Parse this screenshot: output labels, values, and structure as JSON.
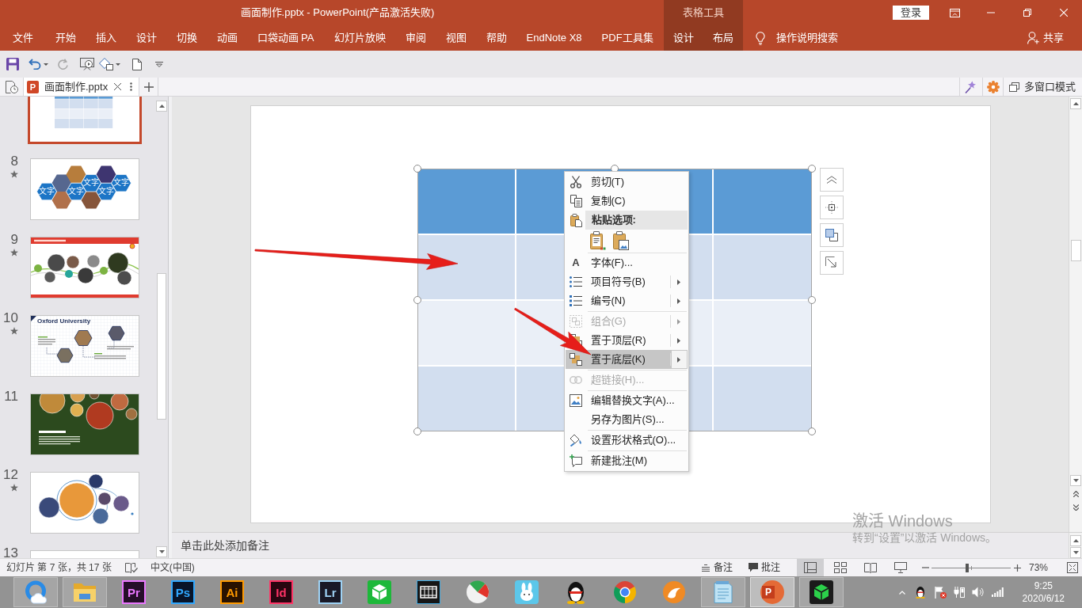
{
  "window": {
    "title": "画面制作.pptx - PowerPoint(产品激活失败)",
    "tool_group": "表格工具",
    "sign_in": "登录"
  },
  "ribbon_tabs": [
    {
      "label": "文件",
      "kind": "main"
    },
    {
      "label": "开始",
      "kind": "main"
    },
    {
      "label": "插入",
      "kind": "main"
    },
    {
      "label": "设计",
      "kind": "main"
    },
    {
      "label": "切换",
      "kind": "main"
    },
    {
      "label": "动画",
      "kind": "main"
    },
    {
      "label": "口袋动画 PA",
      "kind": "main"
    },
    {
      "label": "幻灯片放映",
      "kind": "main"
    },
    {
      "label": "审阅",
      "kind": "main"
    },
    {
      "label": "视图",
      "kind": "main"
    },
    {
      "label": "帮助",
      "kind": "main"
    },
    {
      "label": "EndNote X8",
      "kind": "main"
    },
    {
      "label": "PDF工具集",
      "kind": "main"
    },
    {
      "label": "设计",
      "kind": "contextual"
    },
    {
      "label": "布局",
      "kind": "contextual"
    }
  ],
  "tell_me": "操作说明搜索",
  "share": "共享",
  "document_tab": {
    "label": "画面制作.pptx",
    "file_badge": "P"
  },
  "multi_window": "多窗口模式",
  "slides": [
    {
      "kind": "table",
      "selected": true,
      "animated": false
    },
    {
      "number": "8",
      "kind": "hexagons",
      "selected": false,
      "animated": true,
      "labels": [
        "文字",
        "文字",
        "文字",
        "文字",
        "文字"
      ]
    },
    {
      "number": "9",
      "kind": "timeline",
      "selected": false,
      "animated": true
    },
    {
      "number": "10",
      "kind": "grid",
      "selected": false,
      "animated": true,
      "title": "Oxford University"
    },
    {
      "number": "11",
      "kind": "food",
      "selected": false,
      "animated": false
    },
    {
      "number": "12",
      "kind": "circles",
      "selected": false,
      "animated": true
    },
    {
      "number": "13",
      "kind": "blank",
      "selected": false,
      "animated": false
    }
  ],
  "context_menu": [
    {
      "kind": "item",
      "label": "剪切(T)",
      "disabled": false,
      "submenu": false,
      "selected": false
    },
    {
      "kind": "item",
      "label": "复制(C)",
      "disabled": false,
      "submenu": false,
      "selected": false
    },
    {
      "kind": "header",
      "label": "粘贴选项:"
    },
    {
      "kind": "paste_options"
    },
    {
      "kind": "separator"
    },
    {
      "kind": "item",
      "label": "字体(F)...",
      "glyph": "A",
      "disabled": false,
      "submenu": false,
      "selected": false
    },
    {
      "kind": "item",
      "label": "项目符号(B)",
      "disabled": false,
      "submenu": true,
      "selected": false
    },
    {
      "kind": "item",
      "label": "编号(N)",
      "disabled": false,
      "submenu": true,
      "selected": false
    },
    {
      "kind": "separator"
    },
    {
      "kind": "item",
      "label": "组合(G)",
      "disabled": true,
      "submenu": true,
      "selected": false
    },
    {
      "kind": "item",
      "label": "置于顶层(R)",
      "disabled": false,
      "submenu": true,
      "selected": false
    },
    {
      "kind": "item",
      "label": "置于底层(K)",
      "disabled": false,
      "submenu": true,
      "selected": true
    },
    {
      "kind": "separator"
    },
    {
      "kind": "item",
      "label": "超链接(H)...",
      "disabled": true,
      "submenu": false,
      "selected": false
    },
    {
      "kind": "separator"
    },
    {
      "kind": "item",
      "label": "编辑替换文字(A)...",
      "disabled": false,
      "submenu": false,
      "selected": false
    },
    {
      "kind": "item",
      "label": "另存为图片(S)...",
      "disabled": false,
      "submenu": false,
      "selected": false
    },
    {
      "kind": "separator"
    },
    {
      "kind": "item",
      "label": "设置形状格式(O)...",
      "disabled": false,
      "submenu": false,
      "selected": false
    },
    {
      "kind": "separator"
    },
    {
      "kind": "item",
      "label": "新建批注(M)",
      "disabled": false,
      "submenu": false,
      "selected": false
    }
  ],
  "notes": {
    "placeholder": "单击此处添加备注"
  },
  "activation_notice": {
    "title": "激活 Windows",
    "hint": "转到“设置”以激活 Windows。"
  },
  "status_bar": {
    "slide_info": "幻灯片 第 7 张，共 17 张",
    "language": "中文(中国)",
    "notes": "备注",
    "comments": "批注",
    "views": [
      {
        "selected": true
      },
      {
        "selected": false
      },
      {
        "selected": false
      },
      {
        "selected": false
      }
    ],
    "zoom": {
      "level": 0.45,
      "reading": "73%"
    }
  },
  "taskbar": {
    "apps": [
      {
        "kind": "browser",
        "running": true,
        "selected": false
      },
      {
        "kind": "folder",
        "running": true,
        "selected": false
      },
      {
        "kind": "letter_tile",
        "logo_text": "Pr",
        "color": "#ea77ff",
        "running": false,
        "selected": false
      },
      {
        "kind": "letter_tile",
        "logo_text": "Ps",
        "color": "#31a8ff",
        "running": false,
        "selected": false
      },
      {
        "kind": "letter_tile",
        "logo_text": "Ai",
        "color": "#ff9a00",
        "running": false,
        "selected": false
      },
      {
        "kind": "letter_tile",
        "logo_text": "Id",
        "color": "#ff3366",
        "running": false,
        "selected": false
      },
      {
        "kind": "letter_tile",
        "logo_text": "Lr",
        "color": "#9ed2f5",
        "running": false,
        "selected": false
      },
      {
        "kind": "cube",
        "running": false,
        "selected": false
      },
      {
        "kind": "film",
        "running": false,
        "selected": false
      },
      {
        "kind": "pie",
        "running": false,
        "selected": false
      },
      {
        "kind": "bunny",
        "running": false,
        "selected": false
      },
      {
        "kind": "penguin",
        "running": false,
        "selected": false
      },
      {
        "kind": "wheel",
        "running": false,
        "selected": false
      },
      {
        "kind": "round",
        "running": false,
        "selected": false
      },
      {
        "kind": "notepad",
        "running": true,
        "selected": false
      },
      {
        "kind": "presentation",
        "logo_text": "P",
        "running": true,
        "selected": true
      },
      {
        "kind": "cube_dark",
        "running": true,
        "selected": false
      }
    ],
    "clock": {
      "time": "9:25",
      "date": "2020/6/12"
    }
  }
}
